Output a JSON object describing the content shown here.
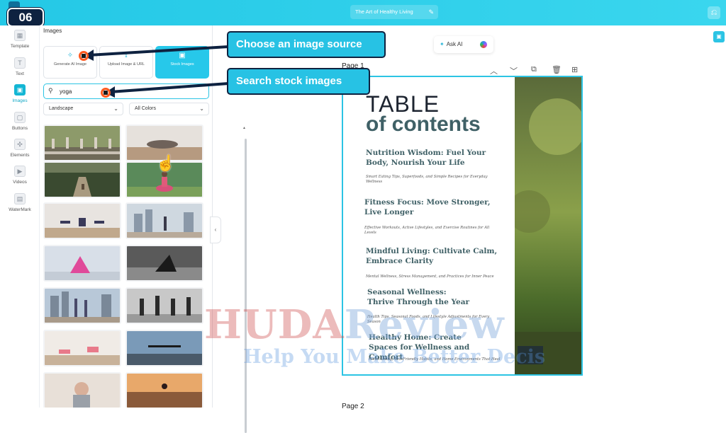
{
  "header": {
    "step_badge": "06",
    "doc_title": "The Art of Healthy Living",
    "edit_icon": "edit-icon",
    "undo_icon": "undo-icon"
  },
  "sidebar": {
    "items": [
      {
        "label": "Template",
        "icon": "template-icon"
      },
      {
        "label": "Text",
        "icon": "text-icon"
      },
      {
        "label": "Images",
        "icon": "images-icon",
        "active": true
      },
      {
        "label": "Buttons",
        "icon": "buttons-icon"
      },
      {
        "label": "Elements",
        "icon": "elements-icon"
      },
      {
        "label": "Videos",
        "icon": "videos-icon"
      },
      {
        "label": "WaterMark",
        "icon": "watermark-icon"
      }
    ]
  },
  "panel": {
    "title": "Images",
    "sources": [
      {
        "label": "Generate AI Image"
      },
      {
        "label": "Upload Image & URL"
      },
      {
        "label": "Stock Images",
        "active": true
      }
    ],
    "search": {
      "value": "yoga"
    },
    "orientation": "Landscape",
    "color": "All Colors"
  },
  "canvas": {
    "ask_ai": "Ask AI",
    "page_label": "Page 1",
    "page_label_next": "Page 2",
    "toc_title_1": "TABLE",
    "toc_title_2": "of contents",
    "toc": [
      {
        "heading": "Nutrition Wisdom: Fuel Your Body, Nourish Your Life",
        "sub": "Smart Eating Tips, Superfoods, and Simple Recipes for Everyday Wellness"
      },
      {
        "heading": "Fitness Focus: Move Stronger, Live Longer",
        "sub": "Effective Workouts, Active Lifestyles, and Exercise Routines for All Levels"
      },
      {
        "heading": "Mindful Living: Cultivate Calm, Embrace Clarity",
        "sub": "Mental Wellness, Stress Management, and Practices for Inner Peace"
      },
      {
        "heading": "Seasonal Wellness: Thrive Through the Year",
        "sub": "Health Tips, Seasonal Foods, and Lifestyle Adjustments for Every Season"
      },
      {
        "heading": "Healthy Home: Create Spaces for Wellness and Comfort",
        "sub": "Clean Living, Eco-Friendly Habits, and Home Environments That Heal"
      }
    ]
  },
  "annotations": {
    "callout_source": "Choose an image source",
    "callout_search": "Search stock images"
  },
  "watermark": {
    "line1_a": "HUDA",
    "line1_b": "Review",
    "line2": "Help You Make Better Decis"
  }
}
